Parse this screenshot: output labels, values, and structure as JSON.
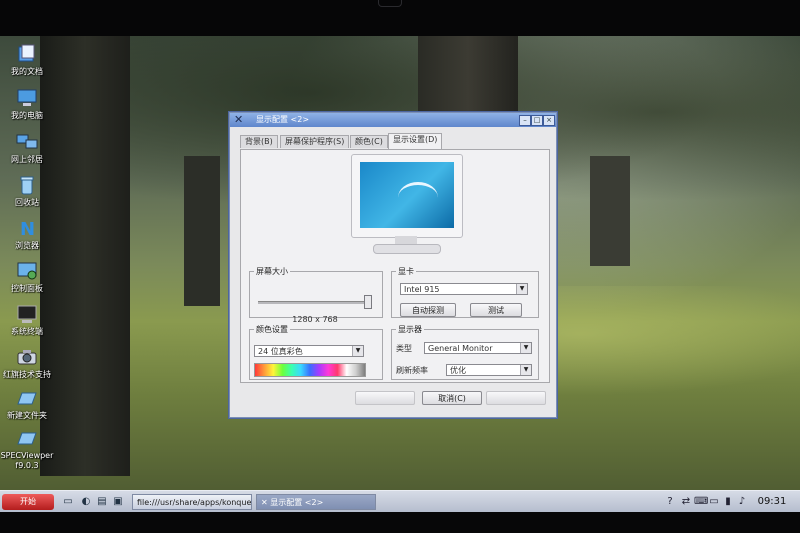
{
  "desktop": {
    "icons": [
      {
        "label": "我的文档",
        "icon": "my-documents-icon"
      },
      {
        "label": "我的电脑",
        "icon": "my-computer-icon"
      },
      {
        "label": "网上邻居",
        "icon": "network-icon"
      },
      {
        "label": "回收站",
        "icon": "trash-icon"
      },
      {
        "label": "浏览器",
        "icon": "browser-icon"
      },
      {
        "label": "控制面板",
        "icon": "control-panel-icon"
      },
      {
        "label": "系统终端",
        "icon": "terminal-icon"
      },
      {
        "label": "红旗技术支持",
        "icon": "camera-icon"
      },
      {
        "label": "新建文件夹",
        "icon": "folder-icon"
      },
      {
        "label": "SPECViewperf9.0.3",
        "icon": "folder-icon"
      }
    ]
  },
  "dialog": {
    "title": "显示配置 <2>",
    "tabs": [
      {
        "label": "背景(B)"
      },
      {
        "label": "屏幕保护程序(S)"
      },
      {
        "label": "颜色(C)"
      },
      {
        "label": "显示设置(D)"
      }
    ],
    "active_tab": "显示设置(D)",
    "screen_size": {
      "legend": "屏幕大小",
      "resolution": "1280 x 768",
      "slider_value": "1280 x 768"
    },
    "graphics_card": {
      "legend": "显卡",
      "card": "Intel 915",
      "auto_detect_label": "自动探测",
      "test_label": "测试"
    },
    "color_settings": {
      "legend": "颜色设置",
      "depth": "24 位真彩色"
    },
    "monitor": {
      "legend": "显示器",
      "type_label": "类型",
      "type_value": "General Monitor",
      "refresh_label": "刷新频率",
      "refresh_value": "优化"
    },
    "buttons": {
      "ok": "",
      "cancel": "取消(C)",
      "apply": ""
    }
  },
  "taskbar": {
    "start_label": "开始",
    "tasks": [
      {
        "label": "file:///usr/share/apps/konquerc"
      },
      {
        "label": "显示配置 <2>"
      }
    ],
    "clock": "09:31"
  },
  "colors": {
    "titlebar": "#6d93d6",
    "start_button": "#c92b2b",
    "dialog_bg": "#e8e8ea"
  }
}
